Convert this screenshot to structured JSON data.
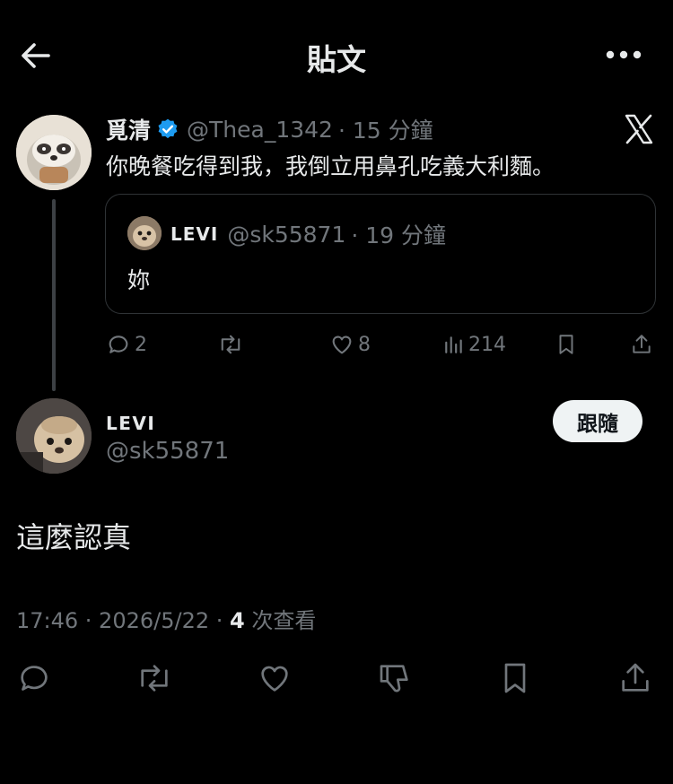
{
  "header": {
    "title": "貼文"
  },
  "parent": {
    "name": "覓清",
    "handle": "@Thea_1342",
    "time": "· 15 分鐘",
    "text": "你晚餐吃得到我，我倒立用鼻孔吃義大利麵。",
    "quote": {
      "name": "LEVI",
      "handle": "@sk55871",
      "time": "· 19 分鐘",
      "text": "妳"
    },
    "stats": {
      "replies": "2",
      "likes": "8",
      "views": "214"
    }
  },
  "reply": {
    "name": "LEVI",
    "handle": "@sk55871",
    "follow_label": "跟隨",
    "text": "這麼認真",
    "time_date": "17:46 · 2026/5/22 ·",
    "views_count": "4",
    "views_label": "次查看"
  },
  "colors": {
    "accent": "#1d9bf0",
    "muted": "#71767b",
    "text": "#e7e9ea"
  }
}
